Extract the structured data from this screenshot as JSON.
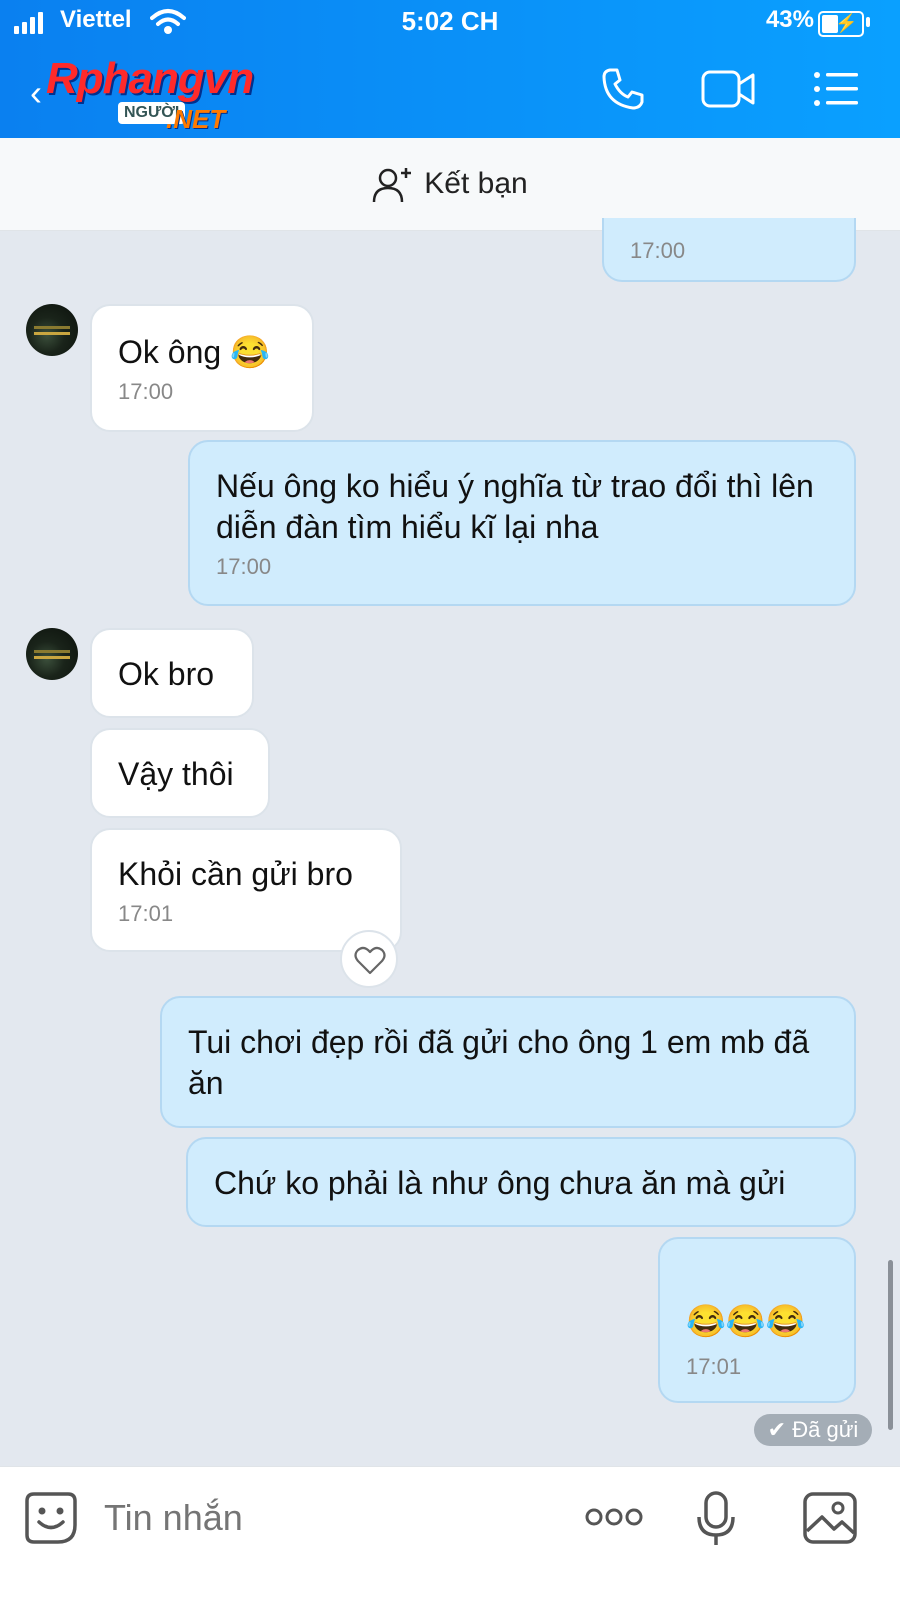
{
  "status_bar": {
    "carrier": "Viettel",
    "time": "5:02 CH",
    "battery": "43%"
  },
  "header": {
    "logo_main": "Rphang",
    "logo_vn": "vn",
    "logo_badge": "NGƯỜI",
    "logo_net": ".NET"
  },
  "friend_bar": {
    "label": "Kết bạn"
  },
  "messages": [
    {
      "text": "",
      "time": "17:00",
      "mine": true
    },
    {
      "text": "Ok ông 😂",
      "time": "17:00",
      "mine": false
    },
    {
      "text": "Nếu ông ko hiểu ý nghĩa từ trao đổi thì lên diễn đàn tìm hiểu kĩ lại nha",
      "time": "17:00",
      "mine": true
    },
    {
      "text": "Ok bro",
      "time": "",
      "mine": false
    },
    {
      "text": "Vậy thôi",
      "time": "",
      "mine": false
    },
    {
      "text": "Khỏi cần gửi bro",
      "time": "17:01",
      "mine": false
    },
    {
      "text": "Tui chơi đẹp rồi đã gửi cho ông 1 em mb đã ăn",
      "time": "",
      "mine": true
    },
    {
      "text": "Chứ ko phải là như ông chưa ăn mà gửi",
      "time": "",
      "mine": true
    },
    {
      "text": "😂😂😂",
      "time": "17:01",
      "mine": true
    }
  ],
  "sent_status": "✔ Đã gửi",
  "composer": {
    "placeholder": "Tin nhắn"
  },
  "icons": [
    "back-icon",
    "phone-icon",
    "video-call-icon",
    "menu-icon",
    "add-friend-icon",
    "heart-icon",
    "sticker-icon",
    "more-icon",
    "microphone-icon",
    "image-icon"
  ],
  "colors": {
    "header": "#0a8ff5",
    "my_bubble": "#d0ecfd",
    "their_bubble": "#ffffff",
    "background": "#e3e8ef"
  }
}
